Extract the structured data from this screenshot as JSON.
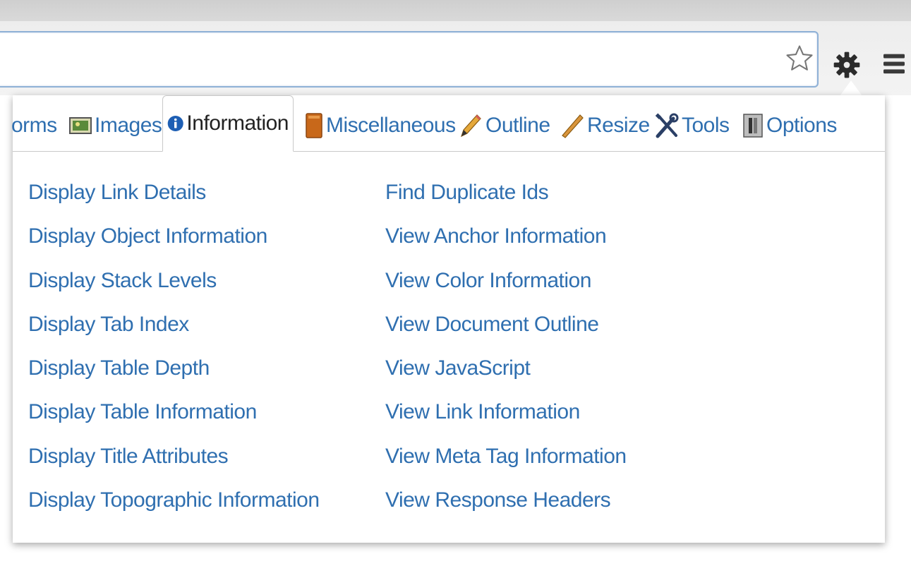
{
  "toolbar": {
    "omnibox_value": "",
    "icons": [
      "star-icon",
      "gear-icon",
      "menu-icon"
    ]
  },
  "tabs": [
    {
      "label": "orms",
      "icon": "forms-icon"
    },
    {
      "label": "Images",
      "icon": "images-icon"
    },
    {
      "label": "Information",
      "icon": "info-icon",
      "active": true
    },
    {
      "label": "Miscellaneous",
      "icon": "miscellaneous-icon"
    },
    {
      "label": "Outline",
      "icon": "pencil-icon"
    },
    {
      "label": "Resize",
      "icon": "ruler-icon"
    },
    {
      "label": "Tools",
      "icon": "tools-icon"
    },
    {
      "label": "Options",
      "icon": "options-icon"
    }
  ],
  "information": {
    "left_links": [
      "Display Link Details",
      "Display Object Information",
      "Display Stack Levels",
      "Display Tab Index",
      "Display Table Depth",
      "Display Table Information",
      "Display Title Attributes",
      "Display Topographic Information"
    ],
    "right_links": [
      "Find Duplicate Ids",
      "View Anchor Information",
      "View Color Information",
      "View Document Outline",
      "View JavaScript",
      "View Link Information",
      "View Meta Tag Information",
      "View Response Headers"
    ]
  },
  "colors": {
    "link": "#2f6fb0",
    "active_tab_text": "#222222",
    "omnibox_border": "#8fb1d6"
  }
}
